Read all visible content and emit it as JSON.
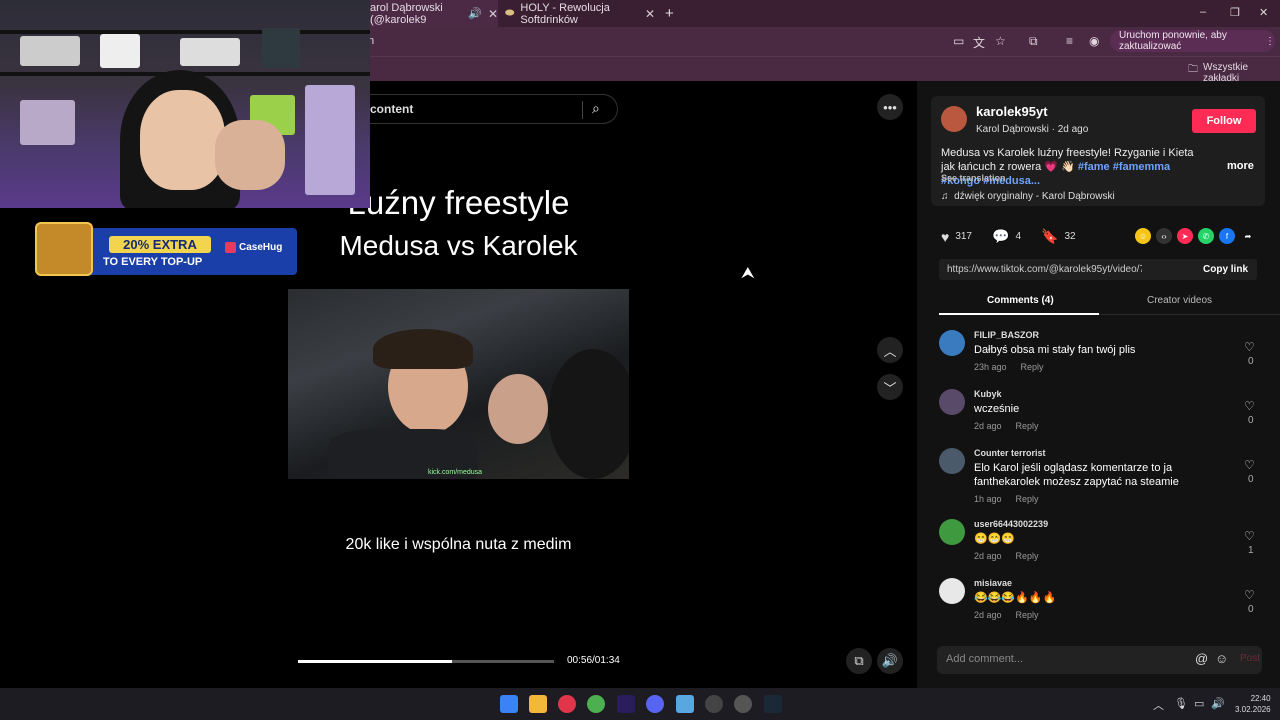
{
  "browser": {
    "tabs": [
      {
        "title": "arol Dąbrowski (@karolek9",
        "active": true
      },
      {
        "title": "HOLY - Rewolucja Softdrinków",
        "active": false
      }
    ],
    "new_tab": "+",
    "window_controls": [
      "–",
      "❐",
      "✕"
    ],
    "address_fragment": "n",
    "update_button": "Uruchom ponownie, aby zaktualizować",
    "bookmarks_all": "Wszystkie zakładki"
  },
  "search": {
    "placeholder": "content"
  },
  "video": {
    "title_line1": "Luźny freestyle",
    "title_line2": "Medusa vs Karolek",
    "overlay_url": "kick.com/medusa",
    "caption": "20k like i wspólna nuta z medim",
    "time": "00:56/01:34",
    "progress": 0.6
  },
  "banner": {
    "extra": "20% EXTRA",
    "sub": "TO EVERY TOP-UP",
    "brand": "CaseHug"
  },
  "post": {
    "username": "karolek95yt",
    "display_name": "Karol Dąbrowski",
    "date": "2d ago",
    "follow_label": "Follow",
    "description": "Medusa vs Karolek luźny freestyle! Rzyganie i Kieta jak łańcuch z rowera 💗 👋🏻 ",
    "hashtags": "#fame #famemma #kongo #medusa...",
    "more_label": "more",
    "translate_label": "See translation",
    "sound": "dźwięk oryginalny - Karol Dąbrowski",
    "likes": "317",
    "comments": "4",
    "saves": "32",
    "link": "https://www.tiktok.com/@karolek95yt/video/76018310...",
    "copy_link_label": "Copy link",
    "tab_comments": "Comments (4)",
    "tab_creator": "Creator videos"
  },
  "comments": [
    {
      "user": "FILIP_BASZOR",
      "text": "Dałbyś obsa mi stały fan twój plis",
      "time": "23h ago",
      "likes": "0",
      "avatar_color": "#3a7bbf"
    },
    {
      "user": "Kubyk",
      "text": "wcześnie",
      "time": "2d ago",
      "likes": "0",
      "avatar_color": "#5a4a6a"
    },
    {
      "user": "Counter terrorist",
      "text": "Elo Karol jeśli oglądasz komentarze to ja fanthekarolek możesz zapytać na steamie",
      "time": "1h ago",
      "likes": "0",
      "avatar_color": "#4a5a6a"
    },
    {
      "user": "user66443002239",
      "text": "😁😁😁",
      "time": "2d ago",
      "likes": "1",
      "avatar_color": "#3f9a3f"
    },
    {
      "user": "misiavae",
      "text": "😂😂😂🔥🔥🔥",
      "time": "2d ago",
      "likes": "0",
      "avatar_color": "#e8e8e8"
    }
  ],
  "reply_label": "Reply",
  "add_comment": {
    "placeholder": "Add comment...",
    "post_label": "Post"
  },
  "taskbar": {
    "time": "22:40",
    "date": "3.02.2026"
  },
  "colors": {
    "accent": "#fe2c55",
    "browser_frame": "#4a2a43"
  }
}
